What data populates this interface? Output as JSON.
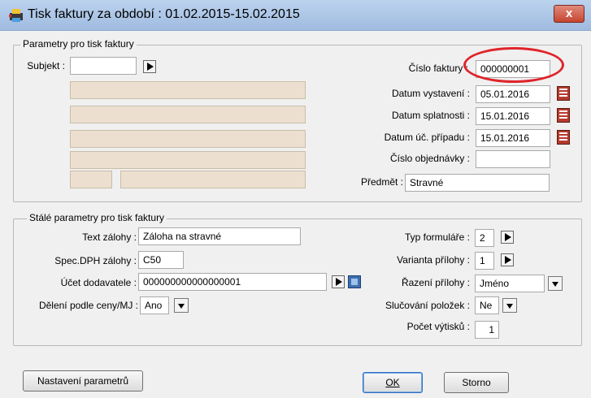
{
  "window": {
    "title": "Tisk faktury za období : 01.02.2015-15.02.2015",
    "close_label": "x",
    "app_icon": "printer-icon"
  },
  "params": {
    "legend": "Parametry pro tisk faktury",
    "subjekt_label": "Subjekt :",
    "subjekt_value": "",
    "cislo_faktury_label": "Číslo faktury :",
    "cislo_faktury_value": "000000001",
    "datum_vystaveni_label": "Datum vystavení :",
    "datum_vystaveni_value": "05.01.2016",
    "datum_splatnosti_label": "Datum splatnosti :",
    "datum_splatnosti_value": "15.01.2016",
    "datum_uc_pripadu_label": "Datum úč. případu :",
    "datum_uc_pripadu_value": "15.01.2016",
    "cislo_objednavky_label": "Číslo objednávky :",
    "cislo_objednavky_value": "",
    "predmet_label": "Předmět :",
    "predmet_value": "Stravné"
  },
  "stale": {
    "legend": "Stálé parametry pro tisk faktury",
    "text_zalohy_label": "Text zálohy :",
    "text_zalohy_value": "Záloha na stravné",
    "spec_dph_label": "Spec.DPH zálohy :",
    "spec_dph_value": "C50",
    "ucet_label": "Účet dodavatele :",
    "ucet_value": "000000000000000001",
    "deleni_label": "Dělení podle ceny/MJ :",
    "deleni_value": "Ano",
    "typ_formulare_label": "Typ formuláře :",
    "typ_formulare_value": "2",
    "varianta_label": "Varianta přílohy :",
    "varianta_value": "1",
    "razeni_label": "Řazení přílohy :",
    "razeni_value": "Jméno",
    "slucovani_label": "Slučování položek :",
    "slucovani_value": "Ne",
    "pocet_label": "Počet výtisků :",
    "pocet_value": "1"
  },
  "buttons": {
    "nastaveni": "Nastavení parametrů",
    "ok": "OK",
    "storno": "Storno"
  },
  "colors": {
    "highlight": "#e0242a",
    "disabled_field": "#ecdfcf"
  }
}
